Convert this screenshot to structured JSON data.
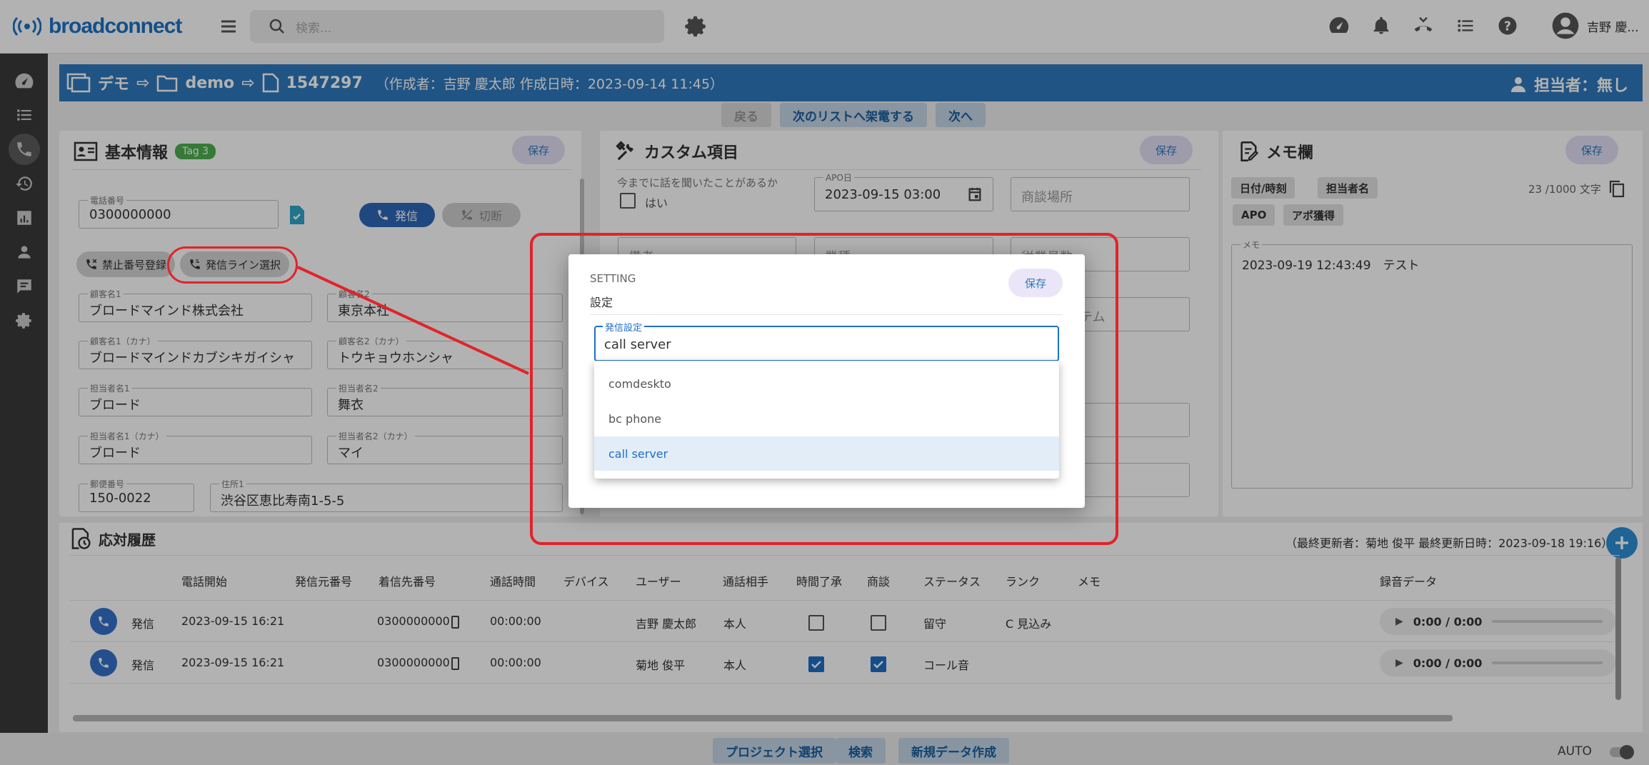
{
  "app": {
    "logo_text": "broadconnect",
    "search_placeholder": "検索...",
    "user_name": "吉野 慶..."
  },
  "header": {
    "crumb1": "デモ",
    "crumb2": "demo",
    "crumb3": "1547297",
    "meta": "（作成者：吉野 慶太郎 作成日時：2023-09-14 11:45）",
    "assignee": "担当者：無し"
  },
  "nav": {
    "back": "戻る",
    "next_list": "次のリストへ架電する",
    "next": "次へ"
  },
  "basic": {
    "title": "基本情報",
    "tag": "Tag 3",
    "save": "保存",
    "phone_label": "電話番号",
    "phone_value": "0300000000",
    "call_btn": "発信",
    "hangup_btn": "切断",
    "chip_block": "禁止番号登録",
    "chip_line": "発信ライン選択",
    "fields": [
      {
        "label": "顧客名1",
        "value": "ブロードマインド株式会社"
      },
      {
        "label": "顧客名2",
        "value": "東京本社"
      },
      {
        "label": "顧客名1（カナ）",
        "value": "ブロードマインドカブシキガイシャ"
      },
      {
        "label": "顧客名2（カナ）",
        "value": "トウキョウホンシャ"
      },
      {
        "label": "担当者名1",
        "value": "ブロード"
      },
      {
        "label": "担当者名2",
        "value": "舞衣"
      },
      {
        "label": "担当者名1（カナ）",
        "value": "ブロード"
      },
      {
        "label": "担当者名2（カナ）",
        "value": "マイ"
      },
      {
        "label": "郵便番号",
        "value": "150-0022"
      },
      {
        "label": "住所1",
        "value": "渋谷区恵比寿南1-5-5"
      }
    ]
  },
  "custom": {
    "title": "カスタム項目",
    "save": "保存",
    "q_label": "今までに話を聞いたことがあるか",
    "q_option": "はい",
    "apo_label": "APO日",
    "apo_value": "2023-09-15 03:00",
    "place_placeholder": "商談場所",
    "f1": "備考",
    "f2": "業種",
    "f3": "従業員数",
    "f4": "システム"
  },
  "memo": {
    "title": "メモ欄",
    "save": "保存",
    "count": "23 /1000 文字",
    "chips": [
      "日付/時刻",
      "担当者名",
      "APO",
      "アポ獲得"
    ],
    "label": "メモ",
    "content": "2023-09-19 12:43:49　テスト"
  },
  "history": {
    "title": "応対履歴",
    "updated": "（最終更新者：菊地 俊平 最終更新日時：2023-09-18 19:16）",
    "columns": [
      "電話開始",
      "発信元番号",
      "着信先番号",
      "通話時間",
      "デバイス",
      "ユーザー",
      "通話相手",
      "時間了承",
      "商談",
      "ステータス",
      "ランク",
      "メモ",
      "録音データ"
    ],
    "rows": [
      {
        "type": "発信",
        "start": "2023-09-15 16:21",
        "to": "0300000000",
        "dur": "00:00:00",
        "user": "吉野 慶太郎",
        "party": "本人",
        "time_ok": false,
        "deal": false,
        "status": "留守",
        "rank": "C 見込み",
        "audio": "0:00 / 0:00"
      },
      {
        "type": "発信",
        "start": "2023-09-15 16:21",
        "to": "0300000000",
        "dur": "00:00:00",
        "user": "菊地 俊平",
        "party": "本人",
        "time_ok": true,
        "deal": true,
        "status": "コール音",
        "rank": "",
        "audio": "0:00 / 0:00"
      }
    ]
  },
  "bottom": {
    "project": "プロジェクト選択",
    "search": "検索",
    "new": "新規データ作成",
    "auto": "AUTO"
  },
  "dialog": {
    "eyebrow": "SETTING",
    "title": "設定",
    "save": "保存",
    "field_label": "発信設定",
    "field_value": "call server",
    "options": [
      "comdeskto",
      "bc phone",
      "call server"
    ],
    "selected": "call server"
  },
  "colors": {
    "primary": "#2e79bd",
    "annotation": "#e0242a",
    "sidebar": "#3a3a3a"
  }
}
